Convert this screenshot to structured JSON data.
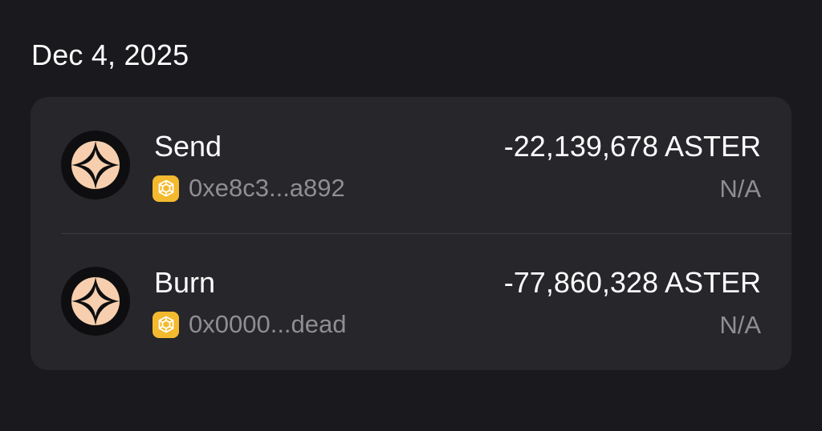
{
  "date_header": "Dec 4, 2025",
  "token_icon": "aster-token-icon",
  "chain_icon": "bnb-chain-icon",
  "colors": {
    "background": "#1a1a1e",
    "card": "#26262b",
    "token_accent": "#f7cfae",
    "chain_accent": "#f3ba2f",
    "secondary_text": "#8e8e93"
  },
  "transactions": [
    {
      "type": "Send",
      "address": "0xe8c3...a892",
      "amount": "-22,139,678 ASTER",
      "fiat_value": "N/A"
    },
    {
      "type": "Burn",
      "address": "0x0000...dead",
      "amount": "-77,860,328 ASTER",
      "fiat_value": "N/A"
    }
  ]
}
